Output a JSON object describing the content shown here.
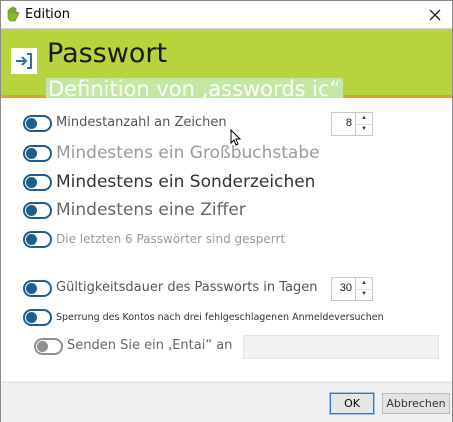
{
  "window": {
    "title": "Edition",
    "close_icon": "close-icon",
    "app_icon": "hand-icon"
  },
  "header": {
    "title": "Passwort",
    "subtitle": "Definition von ‚asswords ic“",
    "icon": "export-icon",
    "colors": {
      "band": "#b8d43c",
      "stripe": "#e79a3a",
      "toggle": "#1f5e8c"
    }
  },
  "options": {
    "min_chars": {
      "label": "Mindestanzahl an Zeichen",
      "on": true,
      "value": "8"
    },
    "uppercase": {
      "label": "Mindestens ein Großbuchstabe",
      "on": true
    },
    "special": {
      "label": "Mindestens ein Sonderzeichen",
      "on": true
    },
    "digit": {
      "label": "Mindestens eine Ziffer",
      "on": true
    },
    "history": {
      "label": "Die letzten 6 Passwörter sind gesperrt",
      "on": true
    },
    "validity": {
      "label": "Gültigkeitsdauer des Passworts in Tagen",
      "on": true,
      "value": "30"
    },
    "lockout": {
      "label": "Sperrung des Kontos nach drei fehlgeschlagenen Anmeldeversuchen",
      "on": true
    },
    "send": {
      "label": "Senden Sie ein ‚Entai“ an",
      "on": false,
      "value": ""
    }
  },
  "footer": {
    "ok_label": "OK",
    "cancel_label": "Abbrechen"
  }
}
